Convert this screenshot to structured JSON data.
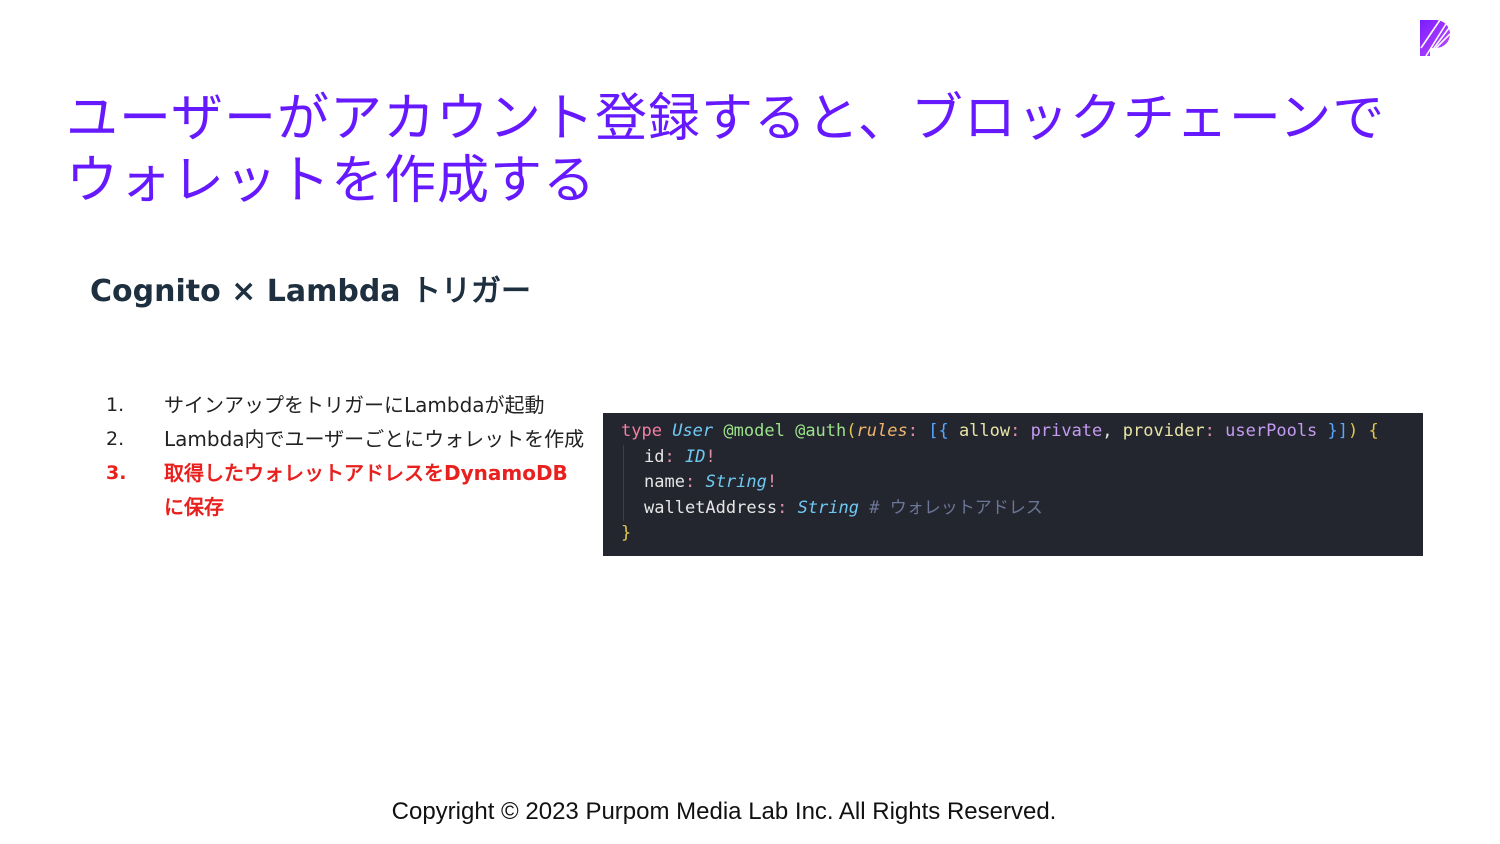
{
  "title": {
    "line1": "ユーザーがアカウント登録すると、ブロックチェーンで",
    "line2": "ウォレットを作成する"
  },
  "subtitle": "Cognito × Lambda トリガー",
  "steps": [
    {
      "num": "1.",
      "text": "サインアップをトリガーにLambdaが起動"
    },
    {
      "num": "2.",
      "text": "Lambda内でユーザーごとにウォレットを作成"
    },
    {
      "num": "3.",
      "text": "取得したウォレットアドレスをDynamoDBに保存"
    }
  ],
  "code": {
    "line1": {
      "type_kw": "type",
      "type_name": "User",
      "model_directive": "@model",
      "auth_directive": "@auth",
      "open_paren": "(",
      "rules_arg": "rules",
      "colon": ":",
      "open_brackets": "[{",
      "allow_key": "allow",
      "private_value": "private",
      "comma": ",",
      "provider_key": "provider",
      "userpools_value": "userPools",
      "close_brackets": "}]",
      "close_paren": ")",
      "open_brace": "{"
    },
    "line2": {
      "field": "id",
      "colon": ":",
      "type": "ID",
      "bang": "!"
    },
    "line3": {
      "field": "name",
      "colon": ":",
      "type": "String",
      "bang": "!"
    },
    "line4": {
      "field": "walletAddress",
      "colon": ":",
      "type": "String",
      "comment": "# ウォレットアドレス"
    },
    "line5": {
      "close_brace": "}"
    }
  },
  "copyright": "Copyright © 2023 Purpom Media Lab Inc. All Rights Reserved.",
  "colors": {
    "title": "#6618ff",
    "highlight": "#e8201e",
    "code_background": "#24262f",
    "logo_primary": "#7a1cff",
    "logo_secondary": "#c04dff"
  },
  "logo": {
    "icon": "purpom-p-logo-icon"
  }
}
